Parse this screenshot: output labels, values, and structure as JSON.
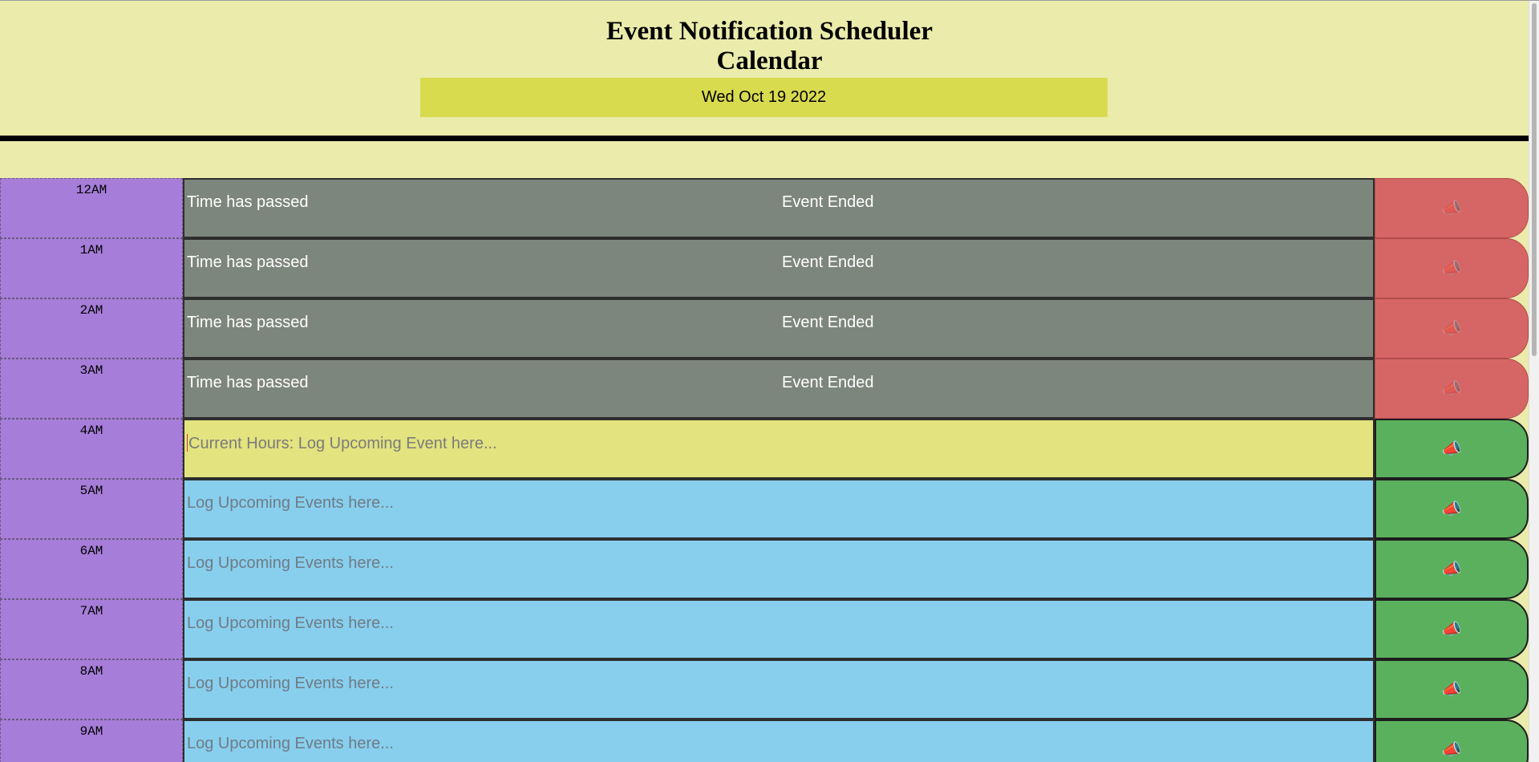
{
  "header": {
    "title_line1": "Event Notification Scheduler",
    "title_line2": "Calendar",
    "date": "Wed Oct 19 2022"
  },
  "save_icon": "📣",
  "rows": [
    {
      "hour": "12AM",
      "state": "past",
      "text": "Time has passed",
      "note": "Event Ended"
    },
    {
      "hour": "1AM",
      "state": "past",
      "text": "Time has passed",
      "note": "Event Ended"
    },
    {
      "hour": "2AM",
      "state": "past",
      "text": "Time has passed",
      "note": "Event Ended"
    },
    {
      "hour": "3AM",
      "state": "past",
      "text": "Time has passed",
      "note": "Event Ended"
    },
    {
      "hour": "4AM",
      "state": "present",
      "placeholder": "Current Hours: Log Upcoming Event here..."
    },
    {
      "hour": "5AM",
      "state": "future",
      "placeholder": "Log Upcoming Events here..."
    },
    {
      "hour": "6AM",
      "state": "future",
      "placeholder": "Log Upcoming Events here..."
    },
    {
      "hour": "7AM",
      "state": "future",
      "placeholder": "Log Upcoming Events here..."
    },
    {
      "hour": "8AM",
      "state": "future",
      "placeholder": "Log Upcoming Events here..."
    },
    {
      "hour": "9AM",
      "state": "future",
      "placeholder": "Log Upcoming Events here..."
    }
  ],
  "colors": {
    "page_bg": "#ebebab",
    "date_bar": "#d9db4f",
    "hour_bg": "#a67dd8",
    "past_bg": "#7d867d",
    "present_bg": "#e3e37f",
    "future_bg": "#88cfee",
    "save_disabled": "#d66665",
    "save_enabled": "#5bb05d"
  }
}
